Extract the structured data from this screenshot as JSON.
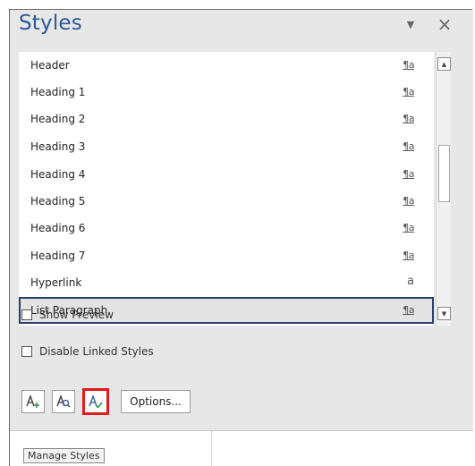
{
  "pane": {
    "title": "Styles",
    "menu_icon": "chevron-down-icon",
    "close_glyph": "×"
  },
  "styles_list": [
    {
      "label": "Header",
      "mark": "¶a"
    },
    {
      "label": "Heading 1",
      "mark": "¶a"
    },
    {
      "label": "Heading 2",
      "mark": "¶a"
    },
    {
      "label": "Heading 3",
      "mark": "¶a"
    },
    {
      "label": "Heading 4",
      "mark": "¶a"
    },
    {
      "label": "Heading 5",
      "mark": "¶a"
    },
    {
      "label": "Heading 6",
      "mark": "¶a"
    },
    {
      "label": "Heading 7",
      "mark": "¶a"
    },
    {
      "label": "Hyperlink",
      "mark": "a"
    },
    {
      "label": "List Paragraph",
      "mark": "¶a",
      "selected": true
    }
  ],
  "options": {
    "show_preview": {
      "label": "Show Preview",
      "checked": false
    },
    "disable_linked_styles": {
      "label": "Disable Linked Styles",
      "checked": false
    }
  },
  "buttons": {
    "new_style_icon": "new-style-icon",
    "style_inspector_icon": "style-inspector-icon",
    "manage_styles_icon": "manage-styles-icon",
    "options_label": "Options..."
  },
  "tooltip": {
    "text": "Manage Styles"
  },
  "colors": {
    "title": "#2b579a",
    "highlight_border": "#e21b1b",
    "selection_border": "#2b3f6b"
  }
}
